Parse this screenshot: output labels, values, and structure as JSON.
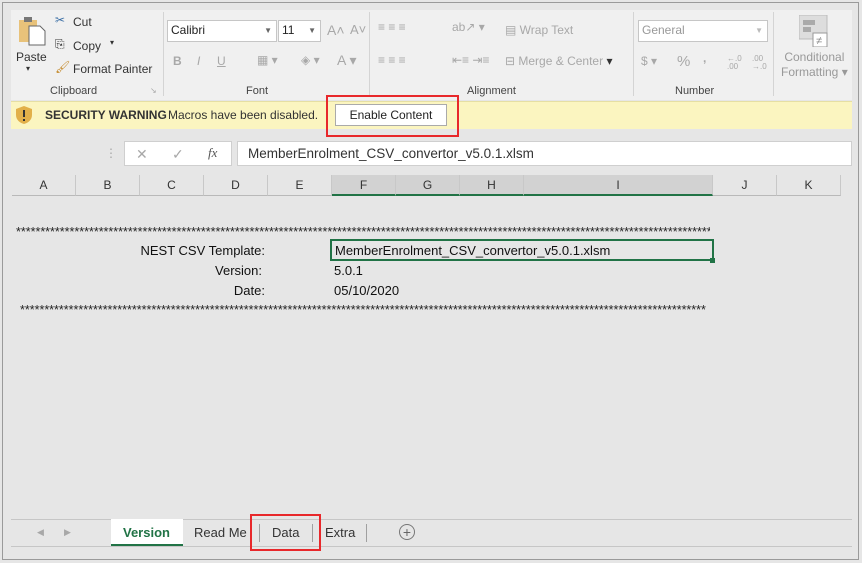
{
  "ribbon": {
    "clipboard": {
      "paste": "Paste",
      "cut": "Cut",
      "copy": "Copy",
      "format_painter": "Format Painter",
      "label": "Clipboard"
    },
    "font": {
      "name": "Calibri",
      "size": "11",
      "label": "Font",
      "bold": "B",
      "italic": "I",
      "underline": "U",
      "color_a": "A"
    },
    "alignment": {
      "wrap_text": "Wrap Text",
      "merge_center": "Merge & Center",
      "label": "Alignment"
    },
    "number": {
      "format": "General",
      "percent": "%",
      "comma": ",",
      "inc_decimal": "←.0 .00",
      "dec_decimal": ".00 →.0",
      "label": "Number"
    },
    "styles": {
      "conditional_formatting_1": "Conditional",
      "conditional_formatting_2": "Formatting"
    }
  },
  "security_bar": {
    "title": "SECURITY WARNING",
    "message": "Macros have been disabled.",
    "button": "Enable Content"
  },
  "formula_bar": {
    "value": "MemberEnrolment_CSV_convertor_v5.0.1.xlsm",
    "fx": "fx",
    "cancel": "✕",
    "enter": "✓"
  },
  "columns": [
    "A",
    "B",
    "C",
    "D",
    "E",
    "F",
    "G",
    "H",
    "I",
    "J",
    "K"
  ],
  "sheet": {
    "stars": "********************************************************************************************************************************************************",
    "rows": [
      {
        "label": "NEST CSV Template:",
        "value": "MemberEnrolment_CSV_convertor_v5.0.1.xlsm"
      },
      {
        "label": "Version:",
        "value": "5.0.1"
      },
      {
        "label": "Date:",
        "value": "05/10/2020"
      }
    ]
  },
  "tabs": [
    {
      "label": "Version",
      "active": true
    },
    {
      "label": "Read Me"
    },
    {
      "label": "Data"
    },
    {
      "label": "Extra"
    }
  ],
  "colors": {
    "accent": "#217346",
    "highlight": "#e8282b",
    "warning_bg": "#fbf5c0"
  }
}
